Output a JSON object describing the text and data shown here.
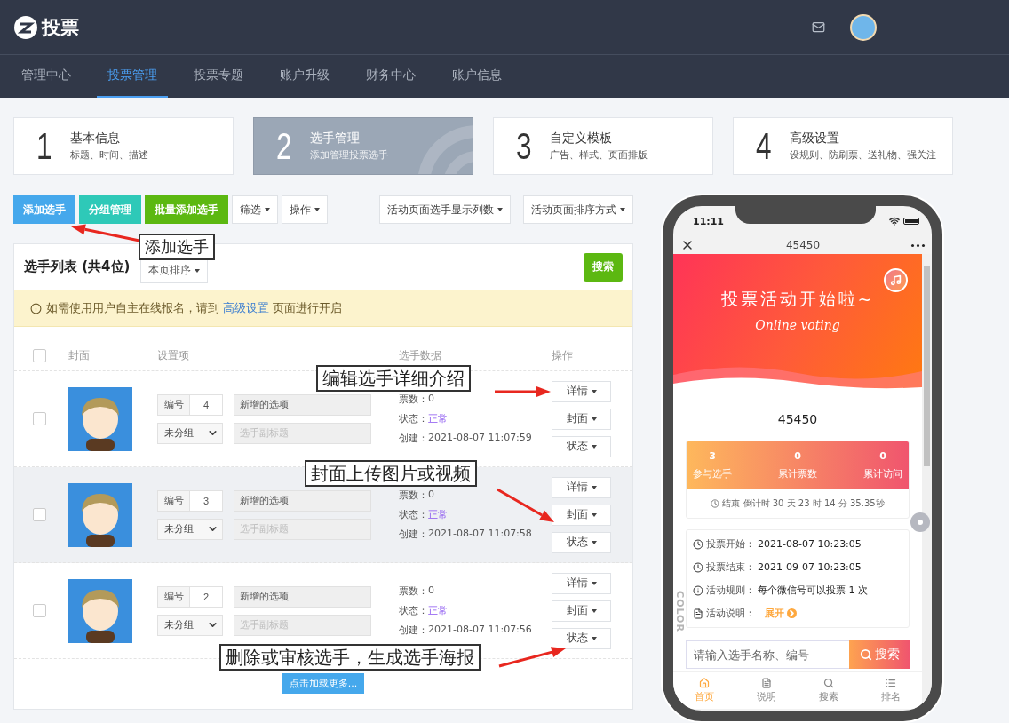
{
  "header": {
    "logo_text": "投票"
  },
  "nav": [
    {
      "label": "管理中心",
      "selected": false
    },
    {
      "label": "投票管理",
      "selected": true
    },
    {
      "label": "投票专题",
      "selected": false
    },
    {
      "label": "账户升级",
      "selected": false
    },
    {
      "label": "财务中心",
      "selected": false
    },
    {
      "label": "账户信息",
      "selected": false
    }
  ],
  "steps": [
    {
      "number": "1",
      "title": "基本信息",
      "subtitle": "标题、时间、描述",
      "selected": false
    },
    {
      "number": "2",
      "title": "选手管理",
      "subtitle": "添加管理投票选手",
      "selected": true
    },
    {
      "number": "3",
      "title": "自定义模板",
      "subtitle": "广告、样式、页面排版",
      "selected": false
    },
    {
      "number": "4",
      "title": "高级设置",
      "subtitle": "设规则、防刷票、送礼物、强关注",
      "selected": false
    }
  ],
  "toolbar": {
    "left": [
      {
        "label": "添加选手",
        "kind": "solid",
        "color": "#45a8ec"
      },
      {
        "label": "分组管理",
        "kind": "solid",
        "color": "#2ec9b8"
      },
      {
        "label": "批量添加选手",
        "kind": "solid",
        "color": "#5cb811"
      },
      {
        "label": "筛选",
        "kind": "dropdown"
      },
      {
        "label": "操作",
        "kind": "dropdown"
      }
    ],
    "right": [
      {
        "label": "活动页面选手显示列数",
        "kind": "dropdown"
      },
      {
        "label": "活动页面排序方式",
        "kind": "dropdown"
      }
    ]
  },
  "list": {
    "title": "选手列表 (共4位)",
    "sort": "本页排序",
    "search_button": "搜索",
    "notice": {
      "before": "如需使用用户自主在线报名，请到 ",
      "link": "高级设置",
      "after": " 页面进行开启"
    },
    "select_all": {
      "checked": false
    },
    "columns": [
      "封面",
      "设置项",
      "选手数据",
      "操作"
    ],
    "rows": [
      {
        "checked": false,
        "highlighted": false,
        "number_label": "编号",
        "number": "4",
        "name": "新增的选项",
        "group": "未分组",
        "subtitle_placeholder": "选手副标题",
        "votes_label": "票数：",
        "votes": "0",
        "status_label": "状态：",
        "status": "正常",
        "created_label": "创建：",
        "created": "2021-08-07 11:07:59",
        "actions": [
          "详情",
          "封面",
          "状态"
        ]
      },
      {
        "checked": false,
        "highlighted": true,
        "number_label": "编号",
        "number": "3",
        "name": "新增的选项",
        "group": "未分组",
        "subtitle_placeholder": "选手副标题",
        "votes_label": "票数：",
        "votes": "0",
        "status_label": "状态：",
        "status": "正常",
        "created_label": "创建：",
        "created": "2021-08-07 11:07:58",
        "actions": [
          "详情",
          "封面",
          "状态"
        ]
      },
      {
        "checked": false,
        "highlighted": false,
        "number_label": "编号",
        "number": "2",
        "name": "新增的选项",
        "group": "未分组",
        "subtitle_placeholder": "选手副标题",
        "votes_label": "票数：",
        "votes": "0",
        "status_label": "状态：",
        "status": "正常",
        "created_label": "创建：",
        "created": "2021-08-07 11:07:56",
        "actions": [
          "详情",
          "封面",
          "状态"
        ]
      }
    ],
    "load_more": "点击加载更多..."
  },
  "annotations": [
    {
      "text": "添加选手"
    },
    {
      "text": "编辑选手详细介绍"
    },
    {
      "text": "封面上传图片或视频"
    },
    {
      "text": "删除或审核选手，生成选手海报"
    }
  ],
  "phone": {
    "time": "11:11",
    "title": "45450",
    "banner_title": "投票活动开始啦~",
    "banner_subtitle": "Online voting",
    "name": "45450",
    "stats": [
      {
        "value": "3",
        "label": "参与选手"
      },
      {
        "value": "0",
        "label": "累计票数"
      },
      {
        "value": "0",
        "label": "累计访问"
      }
    ],
    "countdown": "结束 倒计时 30 天 23 时 14 分 35.35秒",
    "info": [
      {
        "kind": "clock",
        "label": "投票开始：",
        "value": "2021-08-07 10:23:05"
      },
      {
        "kind": "clock",
        "label": "投票结束：",
        "value": "2021-09-07 10:23:05"
      },
      {
        "kind": "info",
        "label": "活动规则：",
        "value": "每个微信号可以投票 1 次"
      },
      {
        "kind": "doc",
        "label": "活动说明：",
        "link": "展开"
      }
    ],
    "search_placeholder": "请输入选手名称、编号",
    "search_button": "搜索",
    "side_text": "COLOR",
    "tabs": [
      {
        "label": "首页",
        "kind": "home",
        "selected": true
      },
      {
        "label": "说明",
        "kind": "doc",
        "selected": false
      },
      {
        "label": "搜索",
        "kind": "search",
        "selected": false
      },
      {
        "label": "排名",
        "kind": "list",
        "selected": false
      }
    ]
  }
}
